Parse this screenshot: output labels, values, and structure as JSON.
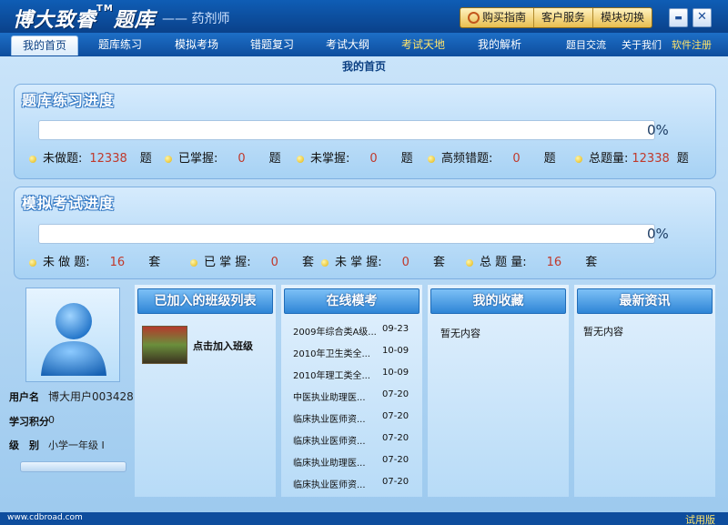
{
  "app": {
    "title": "博大致睿",
    "tm": "TM",
    "title2": "题库",
    "subtitle": "—— 药剂师"
  },
  "topbar": {
    "buy_guide": "购买指南",
    "customer_service": "客户服务",
    "module_switch": "模块切换"
  },
  "window": {
    "minimize": "▬",
    "close": "✕"
  },
  "nav": {
    "tabs": [
      "我的首页",
      "题库练习",
      "模拟考场",
      "错题复习",
      "考试大纲",
      "考试天地",
      "我的解析"
    ],
    "active": "我的首页",
    "right": [
      "题目交流",
      "关于我们",
      "软件注册"
    ]
  },
  "page_title": "我的首页",
  "practice": {
    "title": "题库练习进度",
    "progress": 0,
    "percent_label": "0%",
    "stats": [
      {
        "label": "未做题:",
        "value": "12338",
        "unit": "题"
      },
      {
        "label": "已掌握:",
        "value": "0",
        "unit": "题"
      },
      {
        "label": "未掌握:",
        "value": "0",
        "unit": "题"
      },
      {
        "label": "高频错题:",
        "value": "0",
        "unit": "题"
      },
      {
        "label": "总题量:",
        "value": "12338",
        "unit": "题"
      }
    ]
  },
  "exam": {
    "title": "模拟考试进度",
    "progress": 0,
    "percent_label": "0%",
    "stats": [
      {
        "label": "未 做 题:",
        "value": "16",
        "unit": "套"
      },
      {
        "label": "已 掌 握:",
        "value": "0",
        "unit": "套"
      },
      {
        "label": "未 掌 握:",
        "value": "0",
        "unit": "套"
      },
      {
        "label": "总 题 量:",
        "value": "16",
        "unit": "套"
      }
    ]
  },
  "user": {
    "name_label": "用户名",
    "name_value": "博大用户003428",
    "points_label": "学习积分",
    "points_value": "0",
    "level_label": "级　别",
    "level_value": "小学一年级 I"
  },
  "panels": {
    "classes": {
      "title": "已加入的班级列表",
      "join_label": "点击加入班级"
    },
    "online_exam": {
      "title": "在线模考",
      "items": [
        {
          "name": "2009年综合类A级...",
          "date": "09-23"
        },
        {
          "name": "2010年卫生类全...",
          "date": "10-09"
        },
        {
          "name": "2010年理工类全...",
          "date": "10-09"
        },
        {
          "name": "中医执业助理医...",
          "date": "07-20"
        },
        {
          "name": "临床执业医师资...",
          "date": "07-20"
        },
        {
          "name": "临床执业医师资...",
          "date": "07-20"
        },
        {
          "name": "临床执业助理医...",
          "date": "07-20"
        },
        {
          "name": "临床执业医师资...",
          "date": "07-20"
        }
      ]
    },
    "favorites": {
      "title": "我的收藏",
      "empty": "暂无内容"
    },
    "news": {
      "title": "最新资讯",
      "empty": "暂无内容"
    }
  },
  "status": {
    "url": "www.cdbroad.com",
    "edition": "试用版"
  }
}
